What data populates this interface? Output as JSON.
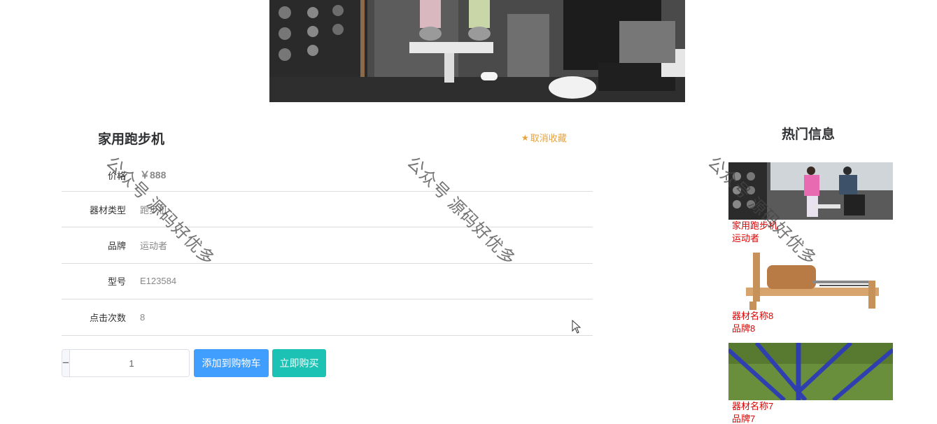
{
  "product": {
    "title": "家用跑步机",
    "favorite_label": "取消收藏",
    "favorite_icon": "star-icon",
    "fields": [
      {
        "label": "价格",
        "value": "￥888"
      },
      {
        "label": "器材类型",
        "value": "跑步机"
      },
      {
        "label": "品牌",
        "value": "运动者"
      },
      {
        "label": "型号",
        "value": "E123584"
      },
      {
        "label": "点击次数",
        "value": "8"
      }
    ],
    "quantity": "1",
    "minus_symbol": "−",
    "plus_symbol": "+",
    "add_to_cart_label": "添加到购物车",
    "buy_now_label": "立即购买"
  },
  "hot": {
    "title": "热门信息",
    "items": [
      {
        "name": "家用跑步机",
        "brand": "运动者"
      },
      {
        "name": "器材名称8",
        "brand": "品牌8"
      },
      {
        "name": "器材名称7",
        "brand": "品牌7"
      }
    ]
  },
  "watermark": "公众号 源码好优多",
  "colors": {
    "favorite": "#e6a23c",
    "cart_button": "#409eff",
    "buy_button": "#1cc2b4",
    "hot_text": "#dd0000"
  }
}
